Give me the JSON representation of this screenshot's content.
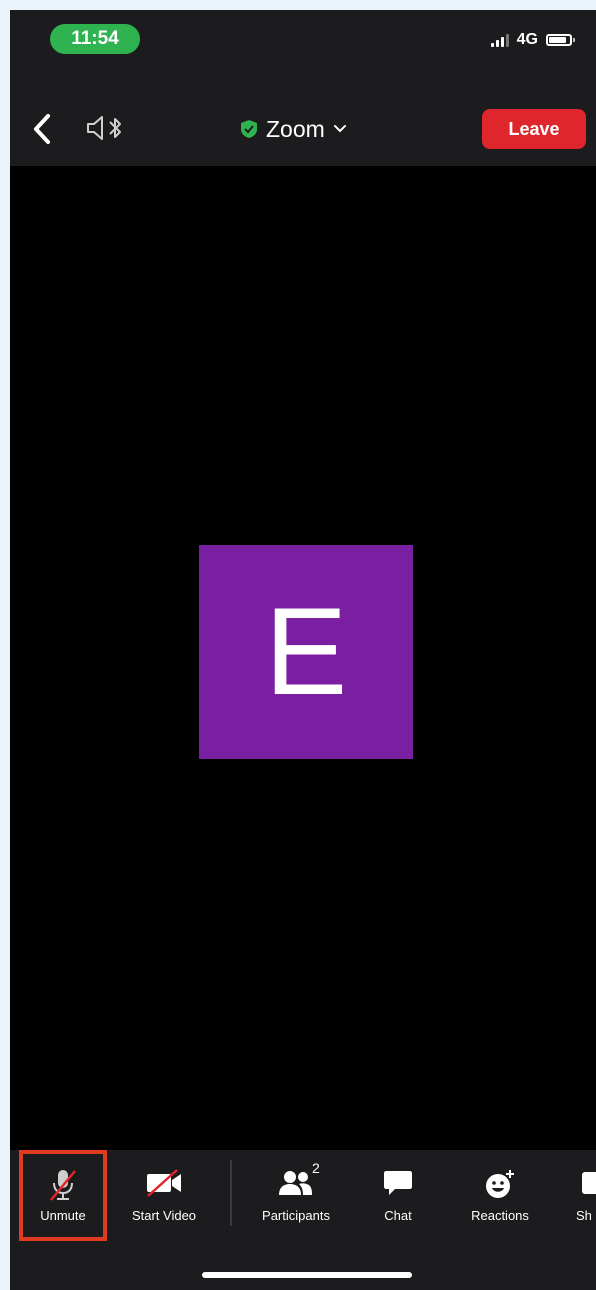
{
  "status_bar": {
    "time": "11:54",
    "network": "4G"
  },
  "meeting_bar": {
    "title": "Zoom",
    "leave_label": "Leave"
  },
  "video": {
    "avatar_initial": "E",
    "avatar_color": "#7b1fa2"
  },
  "toolbar": {
    "unmute_label": "Unmute",
    "start_video_label": "Start Video",
    "participants_label": "Participants",
    "participant_count": "2",
    "chat_label": "Chat",
    "reactions_label": "Reactions",
    "share_label": "Sh"
  },
  "colors": {
    "leave_red": "#e0262d",
    "time_pill_green": "#2fb350",
    "highlight_red": "#e03a22",
    "shield_green": "#2fb350"
  },
  "icons": {
    "back": "chevron-left-icon",
    "speaker": "speaker-bluetooth-icon",
    "shield": "shield-check-icon",
    "dropdown": "chevron-down-icon",
    "mic": "mic-muted-icon",
    "video": "video-off-icon",
    "participants": "participants-icon",
    "chat": "chat-bubble-icon",
    "reactions": "reactions-icon",
    "share": "share-icon"
  }
}
